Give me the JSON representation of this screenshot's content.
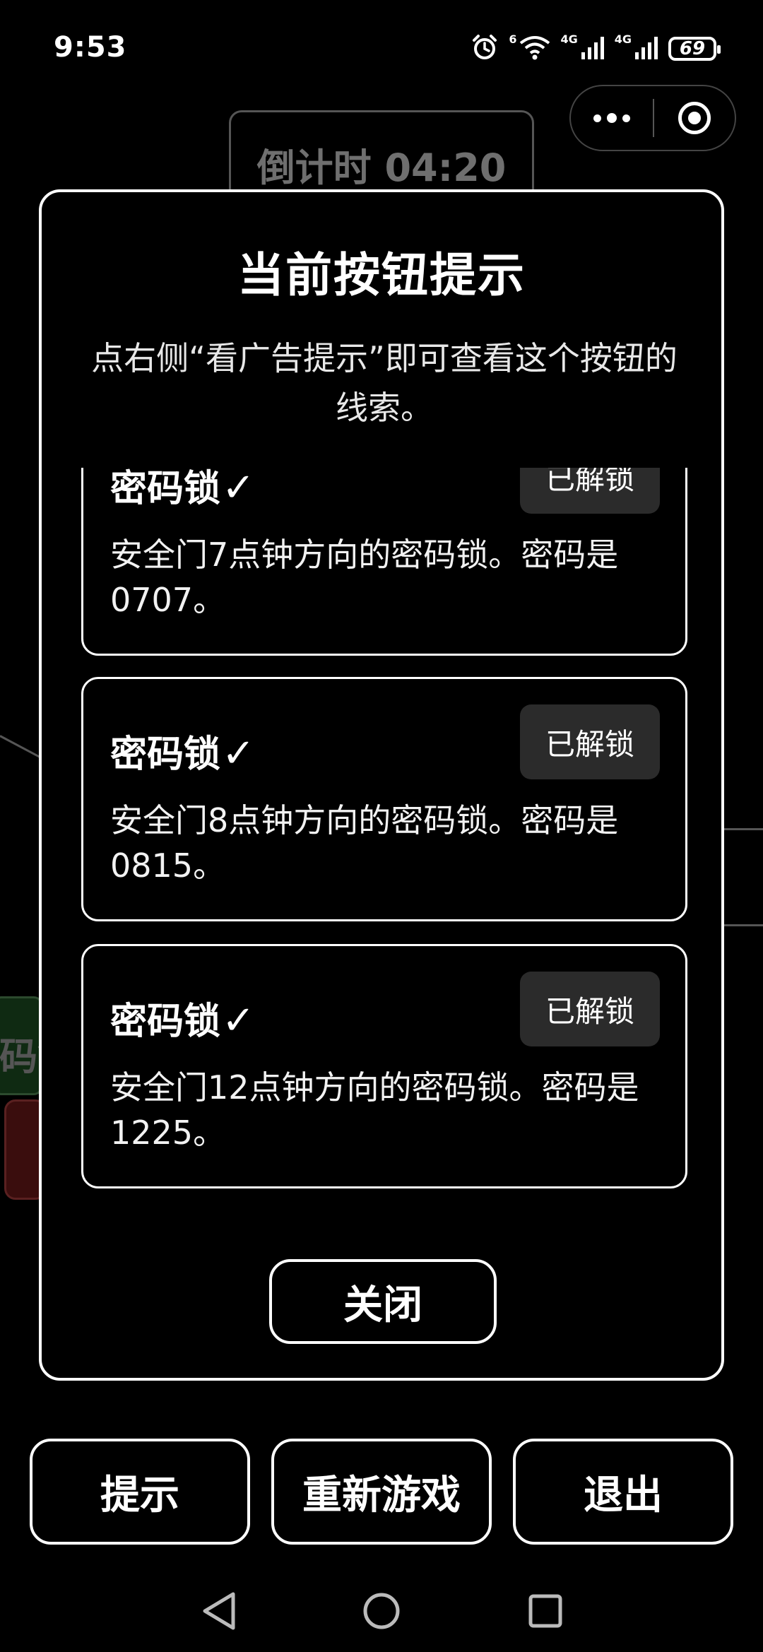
{
  "status_bar": {
    "time": "9:53",
    "wifi_badge": "6",
    "network_1": "4G",
    "network_2": "4G",
    "battery": "69"
  },
  "background": {
    "countdown": "倒计时 04:20",
    "partial_button_text": "码锁"
  },
  "modal": {
    "title": "当前按钮提示",
    "description": "点右侧“看广告提示”即可查看这个按钮的线索。",
    "hints": [
      {
        "name": "密码锁",
        "check": "✓",
        "button": "已解锁",
        "text": "安全门7点钟方向的密码锁。密码是0707。"
      },
      {
        "name": "密码锁",
        "check": "✓",
        "button": "已解锁",
        "text": "安全门8点钟方向的密码锁。密码是0815。"
      },
      {
        "name": "密码锁",
        "check": "✓",
        "button": "已解锁",
        "text": "安全门12点钟方向的密码锁。密码是 1225。"
      }
    ],
    "close_label": "关闭"
  },
  "bottom": {
    "hint_label": "提示",
    "restart_label": "重新游戏",
    "exit_label": "退出"
  },
  "icons": {
    "alarm": "alarm-icon",
    "wifi": "wifi-icon",
    "signal": "signal-icon",
    "more": "more-dots-icon",
    "close_miniprogram": "target-circle-icon",
    "nav_back": "triangle-back-icon",
    "nav_home": "circle-home-icon",
    "nav_recent": "square-recent-icon"
  }
}
